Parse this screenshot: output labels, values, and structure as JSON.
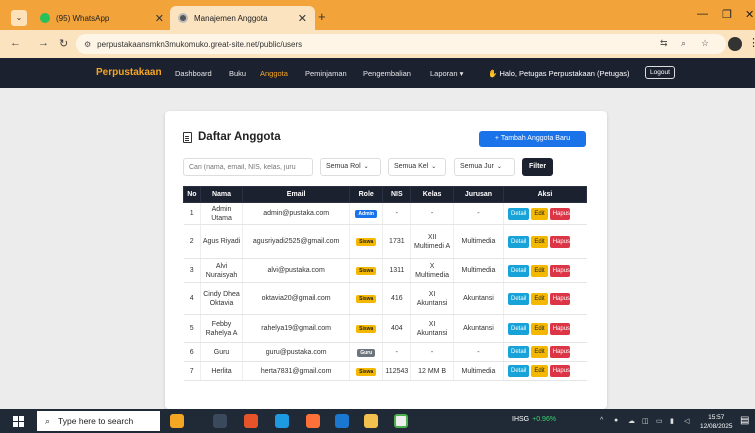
{
  "browser": {
    "tabs": [
      {
        "title": "(95) WhatsApp",
        "active": false,
        "icon": "whatsapp-icon"
      },
      {
        "title": "Manajemen Anggota",
        "active": true,
        "icon": "site-icon"
      }
    ],
    "url": "perpustakaansmkn3mukomuko.great-site.net/public/users"
  },
  "navbar": {
    "brand": "Perpustakaan",
    "links": [
      "Dashboard",
      "Buku",
      "Anggota",
      "Peminjaman",
      "Pengembalian",
      "Laporan ▾"
    ],
    "active_link": "Anggota",
    "greeting": "Halo, Petugas Perpustakaan (Petugas)",
    "logout": "Logout"
  },
  "card": {
    "title": "Daftar Anggota",
    "add_button": "+ Tambah Anggota Baru",
    "search_placeholder": "Cari (nama, email, NIS, kelas, juru",
    "filters": [
      "Semua Rol",
      "Semua Kel",
      "Semua Jur"
    ],
    "filter_button": "Filter"
  },
  "table": {
    "headers": [
      "No",
      "Nama",
      "Email",
      "Role",
      "NIS",
      "Kelas",
      "Jurusan",
      "Aksi"
    ],
    "rows": [
      {
        "no": "1",
        "nama": "Admin Utama",
        "email": "admin@pustaka.com",
        "role": "Admin",
        "nis": "-",
        "kelas": "-",
        "jurusan": "-"
      },
      {
        "no": "2",
        "nama": "Agus Riyadi",
        "email": "agusriyadi2525@gmail.com",
        "role": "Siswa",
        "nis": "1731",
        "kelas": "XII Multimedi A",
        "jurusan": "Multimedia"
      },
      {
        "no": "3",
        "nama": "Alvi Nuraisyah",
        "email": "alvi@pustaka.com",
        "role": "Siswa",
        "nis": "1311",
        "kelas": "X Multimedia",
        "jurusan": "Multimedia"
      },
      {
        "no": "4",
        "nama": "Cindy Dhea Oktavia",
        "email": "oktavia20@gmail.com",
        "role": "Siswa",
        "nis": "416",
        "kelas": "XI Akuntansi",
        "jurusan": "Akuntansi"
      },
      {
        "no": "5",
        "nama": "Febby Rahelya A",
        "email": "rahelya19@gmail.com",
        "role": "Siswa",
        "nis": "404",
        "kelas": "XI Akuntansi",
        "jurusan": "Akuntansi"
      },
      {
        "no": "6",
        "nama": "Guru",
        "email": "guru@pustaka.com",
        "role": "Guru",
        "nis": "-",
        "kelas": "-",
        "jurusan": "-"
      },
      {
        "no": "7",
        "nama": "Herlita",
        "email": "herta7831@gmail.com",
        "role": "Siswa",
        "nis": "112543",
        "kelas": "12 MM B",
        "jurusan": "Multimedia"
      }
    ],
    "actions": [
      "Detail",
      "Edit",
      "Hapus"
    ]
  },
  "taskbar": {
    "search_placeholder": "Type here to search",
    "ticker": "IHSG",
    "ticker_change": "+0.96%",
    "time": "15:57",
    "date": "12/08/2025"
  },
  "colors": {
    "tabbar": "#f2a33a",
    "navbar": "#1c2130",
    "brand": "#f5a623",
    "primary": "#1a73e8",
    "warning": "#f5b800",
    "danger": "#dc3545",
    "info": "#17a2d8"
  }
}
